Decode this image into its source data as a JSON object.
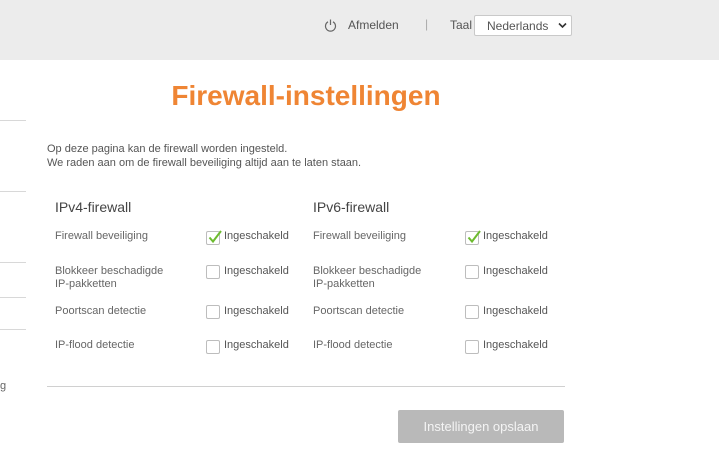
{
  "header": {
    "logout_label": "Afmelden",
    "separator": "|",
    "language_label": "Taal",
    "language_selected": "Nederlands"
  },
  "sidebar": {
    "partial_text": "g"
  },
  "page": {
    "title": "Firewall-instellingen",
    "intro_line1": "Op deze pagina kan de firewall worden ingesteld.",
    "intro_line2": "We raden aan om de firewall beveiliging altijd aan te laten staan."
  },
  "ipv4": {
    "heading": "IPv4-firewall",
    "rows": [
      {
        "label_line1": "Firewall beveiliging",
        "label_line2": "",
        "checkbox_label": "Ingeschakeld",
        "checked": true
      },
      {
        "label_line1": "Blokkeer beschadigde",
        "label_line2": "IP-pakketten",
        "checkbox_label": "Ingeschakeld",
        "checked": false
      },
      {
        "label_line1": "Poortscan detectie",
        "label_line2": "",
        "checkbox_label": "Ingeschakeld",
        "checked": false
      },
      {
        "label_line1": "IP-flood detectie",
        "label_line2": "",
        "checkbox_label": "Ingeschakeld",
        "checked": false
      }
    ]
  },
  "ipv6": {
    "heading": "IPv6-firewall",
    "rows": [
      {
        "label_line1": "Firewall beveiliging",
        "label_line2": "",
        "checkbox_label": "Ingeschakeld",
        "checked": true
      },
      {
        "label_line1": "Blokkeer beschadigde",
        "label_line2": "IP-pakketten",
        "checkbox_label": "Ingeschakeld",
        "checked": false
      },
      {
        "label_line1": "Poortscan detectie",
        "label_line2": "",
        "checkbox_label": "Ingeschakeld",
        "checked": false
      },
      {
        "label_line1": "IP-flood detectie",
        "label_line2": "",
        "checkbox_label": "Ingeschakeld",
        "checked": false
      }
    ]
  },
  "actions": {
    "save_label": "Instellingen opslaan"
  },
  "colors": {
    "accent": "#ef8534",
    "check": "#6dbb2f",
    "button_disabled": "#b9b9b9"
  }
}
